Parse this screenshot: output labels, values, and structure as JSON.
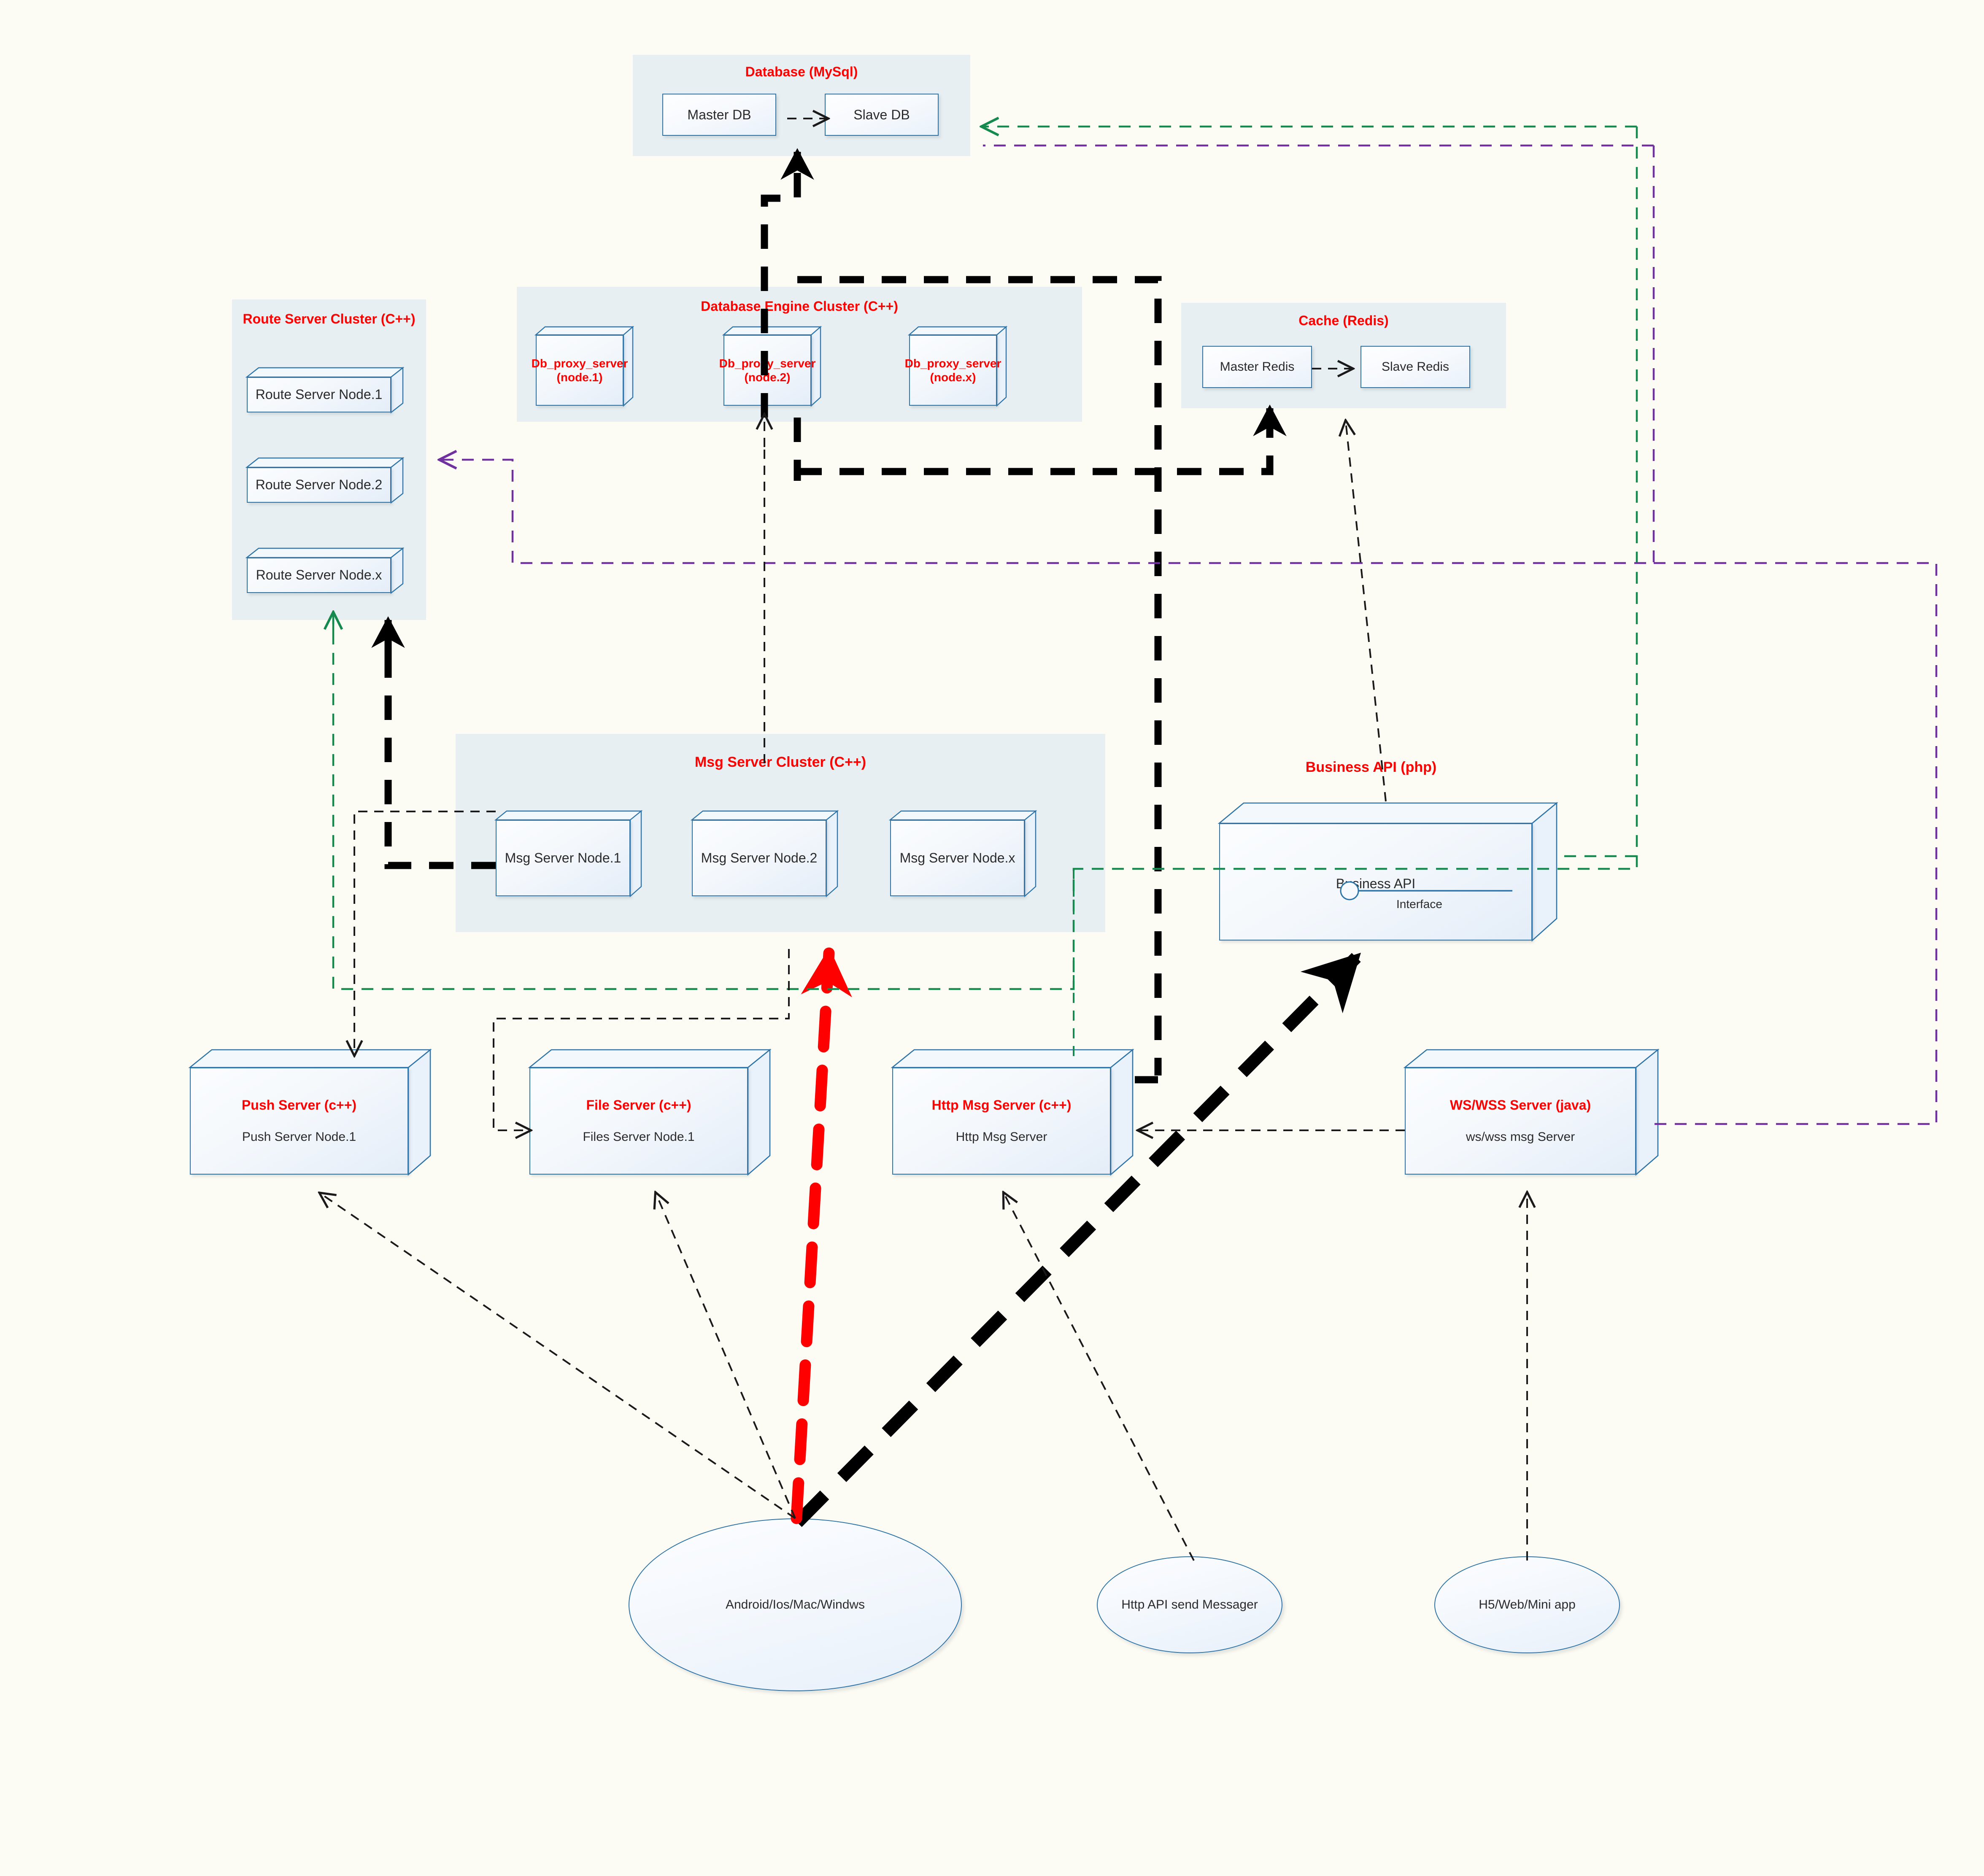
{
  "diagram": {
    "title_colors": {
      "group_title": "#FF0000",
      "box_label_red": "#FF0000",
      "box_label_dark": "#2B2B2B"
    },
    "palette": {
      "background": "#FDFCF4",
      "panel": "#E7EFF2",
      "box_border": "#2E74A8",
      "red_flow": "#FF0000",
      "black_flow": "#000000",
      "green_flow": "#148A4E",
      "purple_flow": "#7030A0"
    }
  },
  "groups": {
    "database": {
      "title": "Database (MySql)",
      "nodes": [
        {
          "label": "Master DB"
        },
        {
          "label": "Slave DB"
        }
      ]
    },
    "route_server_cluster": {
      "title": "Route Server Cluster (C++)",
      "nodes": [
        {
          "label": "Route Server Node.1"
        },
        {
          "label": "Route Server Node.2"
        },
        {
          "label": "Route Server Node.x"
        }
      ]
    },
    "database_engine_cluster": {
      "title": "Database Engine Cluster  (C++)",
      "nodes": [
        {
          "line1": "Db_proxy_server",
          "line2": "(node.1)"
        },
        {
          "line1": "Db_proxy_server",
          "line2": "(node.2)"
        },
        {
          "line1": "Db_proxy_server",
          "line2": "(node.x)"
        }
      ]
    },
    "cache": {
      "title": "Cache (Redis)",
      "nodes": [
        {
          "label": "Master Redis"
        },
        {
          "label": "Slave Redis"
        }
      ]
    },
    "msg_server_cluster": {
      "title": "Msg Server Cluster (C++)",
      "nodes": [
        {
          "label": "Msg Server Node.1"
        },
        {
          "label": "Msg Server Node.2"
        },
        {
          "label": "Msg Server Node.x"
        }
      ]
    }
  },
  "components": {
    "business_api": {
      "title": "Business API (php)",
      "label": "Business API",
      "interface_label": "Interface"
    },
    "push_server": {
      "title": "Push Server (c++)",
      "label": "Push Server Node.1"
    },
    "file_server": {
      "title": "File Server (c++)",
      "label": "Files Server Node.1"
    },
    "http_msg_server": {
      "title": "Http Msg Server (c++)",
      "label": "Http Msg Server"
    },
    "ws_wss_server": {
      "title": "WS/WSS Server (java)",
      "label": "ws/wss msg Server"
    }
  },
  "clients": [
    {
      "label": "Android/Ios/Mac/Windws"
    },
    {
      "label": "Http API send Messager"
    },
    {
      "label": "H5/Web/Mini app"
    }
  ]
}
